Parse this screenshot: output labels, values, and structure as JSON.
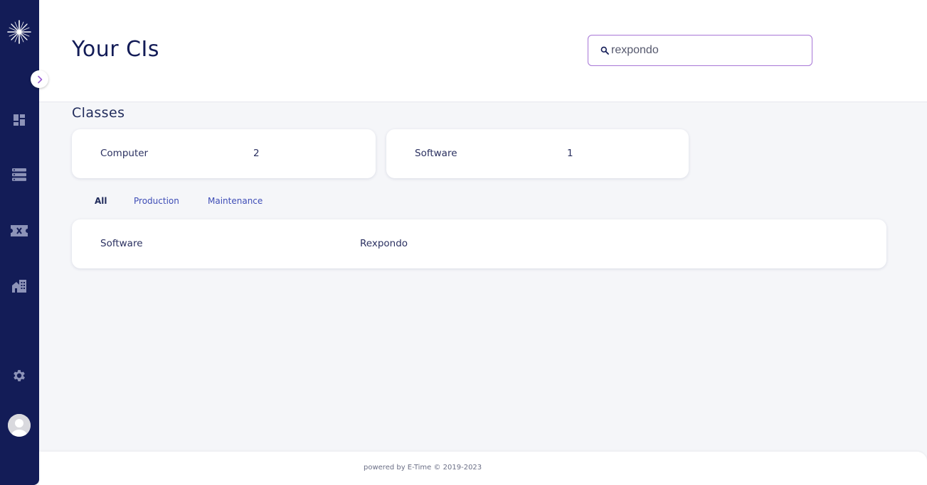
{
  "colors": {
    "sidebar_bg": "#131c57",
    "accent": "#a776d6",
    "link": "#3d4cb6",
    "background": "#f5f6f9"
  },
  "sidebar": {
    "logo_icon": "star-burst-logo",
    "toggle_icon": "chevron-right-icon",
    "items": [
      {
        "icon": "dashboard-icon"
      },
      {
        "icon": "server-list-icon"
      },
      {
        "icon": "ticket-icon"
      },
      {
        "icon": "building-icon"
      }
    ],
    "settings_icon": "gear-icon",
    "avatar_icon": "user-avatar-icon"
  },
  "header": {
    "title": "Your CIs",
    "search": {
      "value": "rexpondo",
      "icon": "search-icon"
    }
  },
  "classes": {
    "title": "Classes",
    "cards": [
      {
        "label": "Computer",
        "count": "2"
      },
      {
        "label": "Software",
        "count": "1"
      }
    ]
  },
  "tabs": [
    {
      "label": "All",
      "active": true
    },
    {
      "label": "Production",
      "active": false
    },
    {
      "label": "Maintenance",
      "active": false
    }
  ],
  "ci_rows": [
    {
      "class": "Software",
      "name": "Rexpondo"
    }
  ],
  "footer": {
    "text": "powered by E-Time © 2019-2023"
  }
}
